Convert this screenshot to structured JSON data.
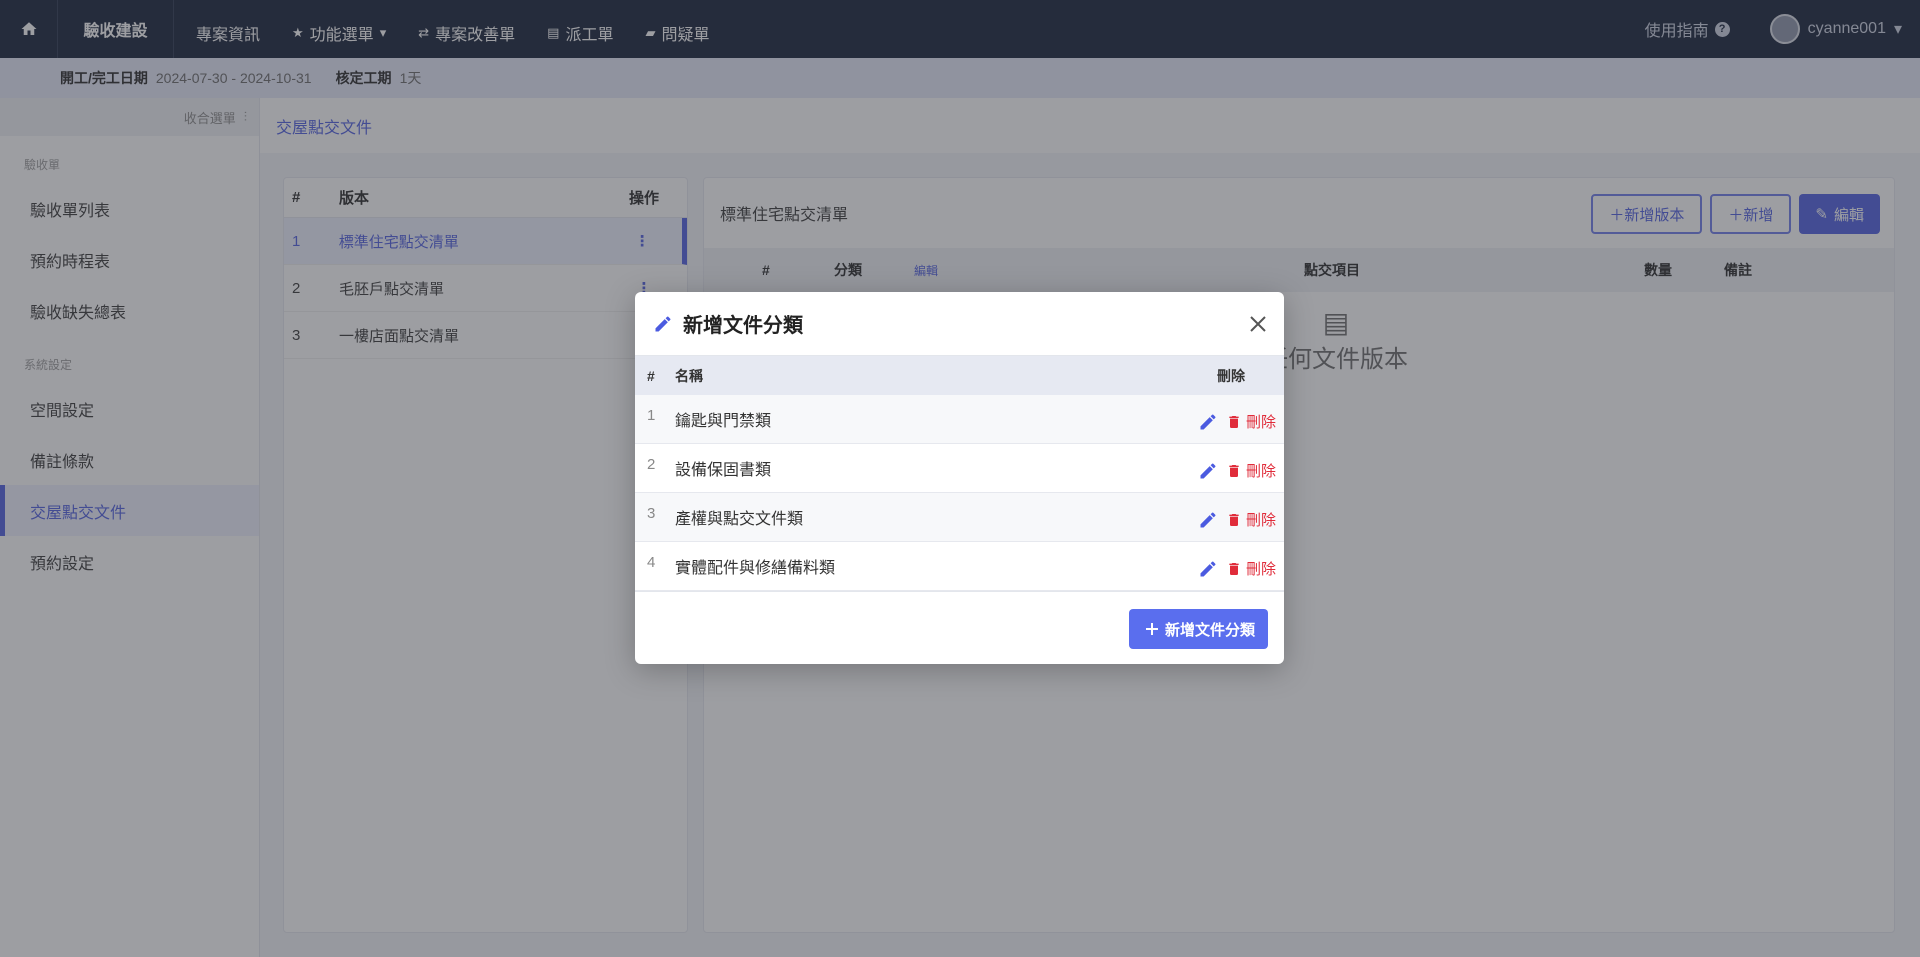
{
  "colors": {
    "accent": "#4b5be0",
    "nav_bg": "#0f1a33",
    "danger": "#e02c3a",
    "button": "#5a6eee"
  },
  "topnav": {
    "brand": "驗收建設",
    "items": [
      {
        "label": "專案資訊",
        "icon": ""
      },
      {
        "label": "功能選單",
        "icon": "star-icon"
      },
      {
        "label": "專案改善單",
        "icon": "swap-icon"
      },
      {
        "label": "派工單",
        "icon": "document-icon"
      },
      {
        "label": "問疑單",
        "icon": "chat-icon"
      }
    ],
    "guide": "使用指南",
    "username": "cyanne001"
  },
  "infobar": {
    "date_label": "開工/完工日期",
    "date_value": "2024-07-30 - 2024-10-31",
    "period_label": "核定工期",
    "period_value": "1天"
  },
  "sidebar": {
    "collapse_label": "收合選單",
    "sections": [
      {
        "title": "驗收單",
        "items": [
          "驗收單列表",
          "預約時程表",
          "驗收缺失總表"
        ]
      },
      {
        "title": "系統設定",
        "items": [
          "空間設定",
          "備註條款",
          "交屋點交文件",
          "預約設定"
        ]
      }
    ],
    "active_item": "交屋點交文件"
  },
  "breadcrumb": "交屋點交文件",
  "versions": {
    "headers": [
      "#",
      "版本",
      "操作"
    ],
    "rows": [
      {
        "num": "1",
        "name": "標準住宅點交清單"
      },
      {
        "num": "2",
        "name": "毛胚戶點交清單"
      },
      {
        "num": "3",
        "name": "一樓店面點交清單"
      }
    ]
  },
  "detail": {
    "title": "標準住宅點交清單",
    "buttons": {
      "add_version": "＋新增版本",
      "add": "＋新增",
      "edit": "編輯"
    },
    "headers": [
      "#",
      "分類",
      "編輯",
      "點交項目",
      "數量",
      "備註"
    ],
    "empty_text": "任何文件版本"
  },
  "modal": {
    "title": "新增文件分類",
    "headers": {
      "num": "#",
      "name": "名稱",
      "delete": "刪除"
    },
    "rows": [
      {
        "num": "1",
        "name": "鑰匙與門禁類"
      },
      {
        "num": "2",
        "name": "設備保固書類"
      },
      {
        "num": "3",
        "name": "產權與點交文件類"
      },
      {
        "num": "4",
        "name": "實體配件與修繕備料類"
      }
    ],
    "delete_label": "刪除",
    "add_button": "新增文件分類"
  }
}
